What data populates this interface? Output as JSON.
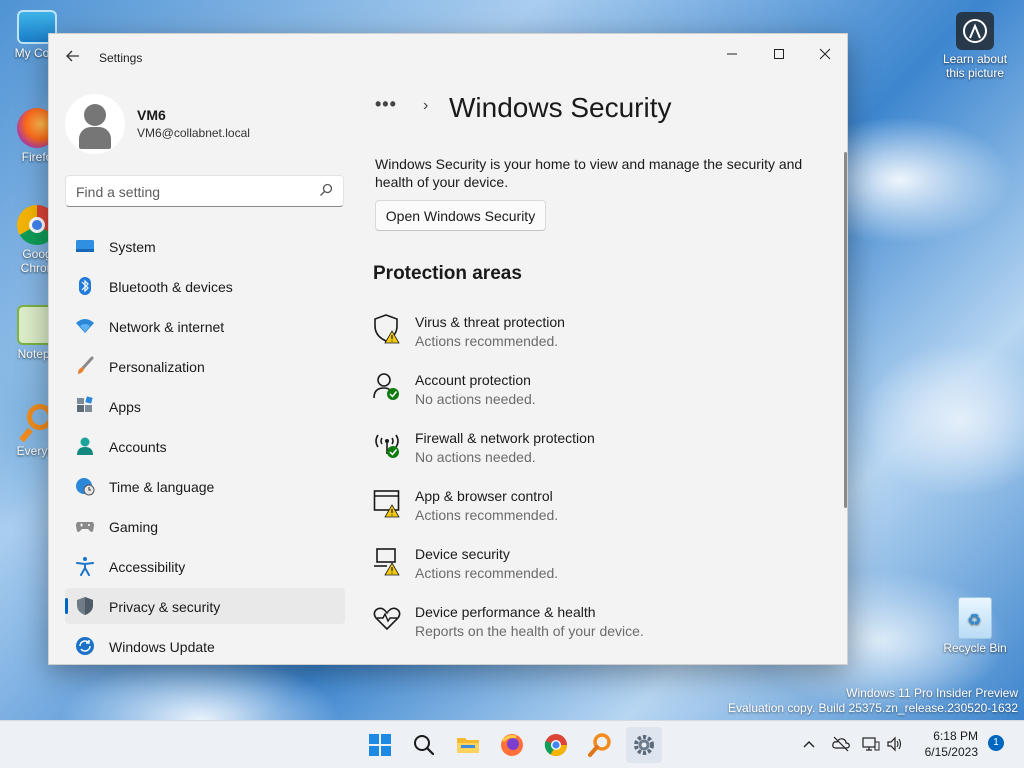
{
  "desktop": {
    "icons": [
      {
        "label": "My Com",
        "icon": "monitor-icon"
      },
      {
        "label": "Firefo",
        "icon": "firefox-icon"
      },
      {
        "label": "Goog Chron",
        "icon": "chrome-icon"
      },
      {
        "label": "Notepa",
        "icon": "notepad-icon"
      },
      {
        "label": "Everyth",
        "icon": "everything-search-icon"
      }
    ],
    "learn_about": "Learn about this picture",
    "recycle_bin": "Recycle Bin"
  },
  "window": {
    "title": "Settings",
    "controls": {
      "minimize": "—",
      "maximize": "☐",
      "close": "✕"
    }
  },
  "profile": {
    "name": "VM6",
    "email": "VM6@collabnet.local"
  },
  "search": {
    "placeholder": "Find a setting",
    "value": ""
  },
  "nav": {
    "items": [
      {
        "label": "System",
        "icon": "system-icon"
      },
      {
        "label": "Bluetooth & devices",
        "icon": "bluetooth-icon"
      },
      {
        "label": "Network & internet",
        "icon": "wifi-icon"
      },
      {
        "label": "Personalization",
        "icon": "brush-icon"
      },
      {
        "label": "Apps",
        "icon": "apps-icon"
      },
      {
        "label": "Accounts",
        "icon": "accounts-icon"
      },
      {
        "label": "Time & language",
        "icon": "globe-clock-icon"
      },
      {
        "label": "Gaming",
        "icon": "gamepad-icon"
      },
      {
        "label": "Accessibility",
        "icon": "accessibility-icon"
      },
      {
        "label": "Privacy & security",
        "icon": "shield-icon",
        "active": true
      },
      {
        "label": "Windows Update",
        "icon": "update-icon"
      }
    ]
  },
  "main": {
    "breadcrumb_more": "•••",
    "breadcrumb_sep": "›",
    "title": "Windows Security",
    "description": "Windows Security is your home to view and manage the security and health of your device.",
    "open_button": "Open Windows Security",
    "section_title": "Protection areas",
    "areas": [
      {
        "title": "Virus & threat protection",
        "status": "Actions recommended.",
        "icon": "virus-shield-icon",
        "state": "warning"
      },
      {
        "title": "Account protection",
        "status": "No actions needed.",
        "icon": "account-icon",
        "state": "ok"
      },
      {
        "title": "Firewall & network protection",
        "status": "No actions needed.",
        "icon": "firewall-icon",
        "state": "ok"
      },
      {
        "title": "App & browser control",
        "status": "Actions recommended.",
        "icon": "browser-icon",
        "state": "warning"
      },
      {
        "title": "Device security",
        "status": "Actions recommended.",
        "icon": "laptop-icon",
        "state": "warning"
      },
      {
        "title": "Device performance & health",
        "status": "Reports on the health of your device.",
        "icon": "heart-icon",
        "state": "none"
      }
    ]
  },
  "watermark": {
    "line1": "Windows 11 Pro Insider Preview",
    "line2": "Evaluation copy. Build 25375.zn_release.230520-1632"
  },
  "taskbar": {
    "apps": [
      "start-icon",
      "search-icon",
      "file-explorer-icon",
      "firefox-icon",
      "chrome-icon",
      "everything-search-icon",
      "settings-gear-icon"
    ],
    "time": "6:18 PM",
    "date": "6/15/2023",
    "notifications": "1"
  },
  "colors": {
    "accent": "#0067c0",
    "warning": "#f2c811",
    "ok": "#107c10"
  }
}
